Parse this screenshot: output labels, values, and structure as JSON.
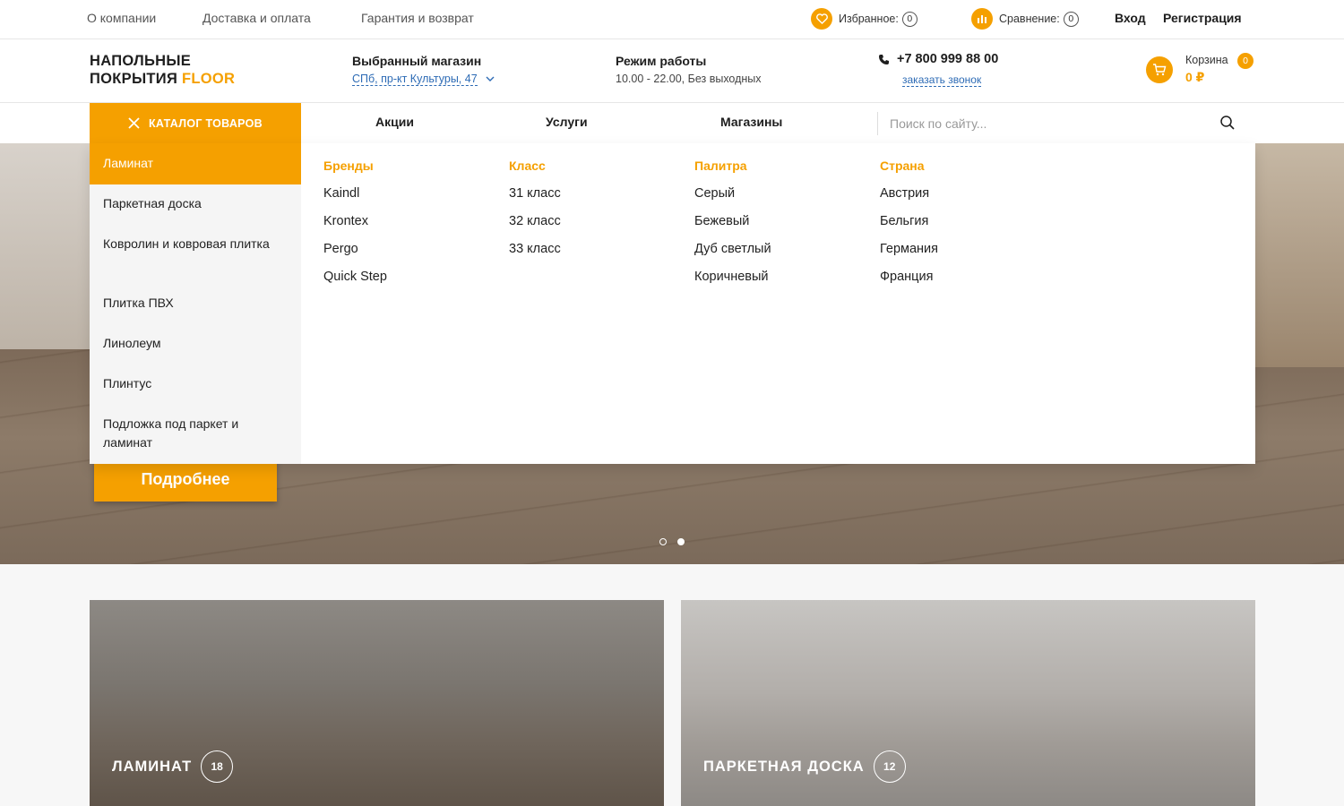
{
  "topbar": {
    "links": [
      "О компании",
      "Доставка и оплата",
      "Гарантия и возврат"
    ],
    "favorites_label": "Избранное:",
    "favorites_count": "0",
    "compare_label": "Сравнение:",
    "compare_count": "0",
    "login": "Вход",
    "register": "Регистрация"
  },
  "header": {
    "logo_line1": "НАПОЛЬНЫЕ",
    "logo_line2": "ПОКРЫТИЯ",
    "logo_accent": "FLOOR",
    "store_title": "Выбранный магазин",
    "store_value": "СПб, пр-кт Культуры, 47",
    "hours_title": "Режим работы",
    "hours_value": "10.00 - 22.00, Без выходных",
    "phone": "+7 800 999 88 00",
    "callback": "заказать звонок",
    "cart_label": "Корзина",
    "cart_count": "0",
    "cart_sum": "0 ₽"
  },
  "nav": {
    "catalog_label": "КАТАЛОГ ТОВАРОВ",
    "links": [
      "Акции",
      "Услуги",
      "Магазины"
    ],
    "search_placeholder": "Поиск по сайту..."
  },
  "catalog": {
    "categories": [
      "Ламинат",
      "Паркетная доска",
      "Ковролин и ковровая плитка",
      "Плитка ПВХ",
      "Линолеум",
      "Плинтус",
      "Подложка под паркет и ламинат"
    ],
    "columns": [
      {
        "title": "Бренды",
        "items": [
          "Kaindl",
          "Krontex",
          "Pergo",
          "Quick Step"
        ]
      },
      {
        "title": "Класс",
        "items": [
          "31 класс",
          "32 класс",
          "33 класс"
        ]
      },
      {
        "title": "Палитра",
        "items": [
          "Серый",
          "Бежевый",
          "Дуб светлый",
          "Коричневый"
        ]
      },
      {
        "title": "Страна",
        "items": [
          "Австрия",
          "Бельгия",
          "Германия",
          "Франция"
        ]
      }
    ]
  },
  "hero": {
    "button": "Подробнее",
    "slides_total": 2,
    "slide_active": 2
  },
  "tiles": [
    {
      "title": "ЛАМИНАТ",
      "count": "18"
    },
    {
      "title": "ПАРКЕТНАЯ ДОСКА",
      "count": "12"
    }
  ],
  "colors": {
    "accent": "#f5a000",
    "link": "#2d6bb5",
    "text": "#1e1e1e"
  }
}
